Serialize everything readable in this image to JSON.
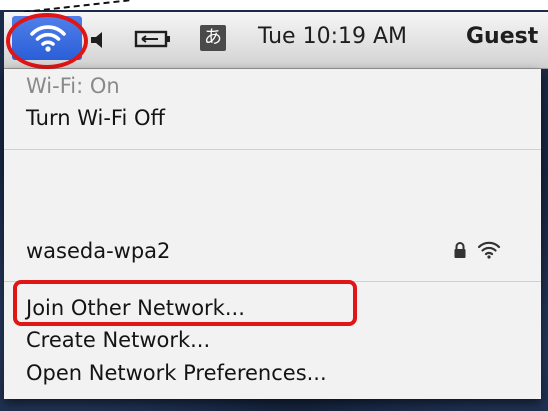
{
  "menubar": {
    "clock": "Tue 10:19 AM",
    "user": "Guest",
    "input_method_glyph": "あ",
    "icons": [
      "wifi-icon",
      "volume-icon",
      "battery-icon",
      "input-method-icon"
    ]
  },
  "menu": {
    "status": "Wi-Fi: On",
    "toggle": "Turn Wi-Fi Off",
    "networks": [
      {
        "name": "waseda-wpa2",
        "secured": true,
        "icons": [
          "lock-icon",
          "wifi-signal-icon"
        ]
      }
    ],
    "join_other": "Join Other Network...",
    "create": "Create Network...",
    "open_prefs": "Open Network Preferences..."
  },
  "colors": {
    "highlight_red": "#e01515",
    "wifi_button_blue": "#2b5fd8",
    "menu_bg": "#f2f2f2"
  }
}
